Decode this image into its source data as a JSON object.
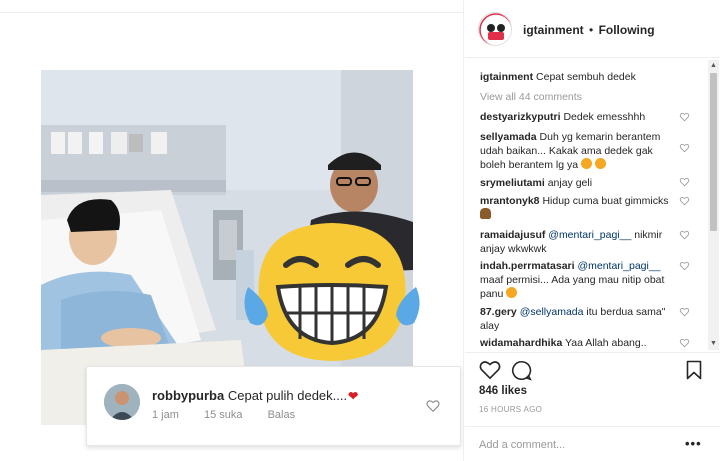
{
  "post": {
    "username": "igtainment",
    "separator": "•",
    "follow_status": "Following",
    "caption_user": "igtainment",
    "caption_text": "Cepat sembuh dedek",
    "view_all": "View all 44 comments",
    "likes": "846 likes",
    "time_ago": "16 HOURS AGO",
    "add_comment_placeholder": "Add a comment...",
    "more_options": "•••"
  },
  "comments": [
    {
      "user": "destyarizkyputri",
      "text": "Dedek emesshhh"
    },
    {
      "user": "sellyamada",
      "text": "Duh yg kemarin berantem udah baikan... Kakak ama dedek gak boleh berantem lg ya"
    },
    {
      "user": "srymeliutami",
      "text": "anjay geli"
    },
    {
      "user": "mrantonyk8",
      "text": "Hidup cuma buat gimmicks"
    },
    {
      "user": "ramaidajusuf",
      "mention": "@mentari_pagi__",
      "text": " nikmir anjay wkwkwk"
    },
    {
      "user": "indah.perrmatasari",
      "mention": "@mentari_pagi__",
      "text": " maaf permisi... Ada yang mau nitip obat panu"
    },
    {
      "user": "87.gery",
      "mention": "@sellyamada",
      "text": " itu berdua sama\" alay"
    },
    {
      "user": "widamahardhika",
      "text": "Yaa Allah abang.."
    }
  ],
  "overlay_comment": {
    "user": "robbypurba",
    "text": "Cepat pulih dedek....",
    "time": "1 jam",
    "likes": "15 suka",
    "reply": "Balas"
  },
  "icons": {
    "heart": "heart-icon",
    "comment": "comment-icon",
    "save": "bookmark-icon",
    "emoji_overlay": "tears-of-joy-emoji"
  },
  "colors": {
    "emoji_yellow": "#f7c936",
    "mention": "#003569",
    "muted": "#999999",
    "red_heart": "#d81f26"
  }
}
